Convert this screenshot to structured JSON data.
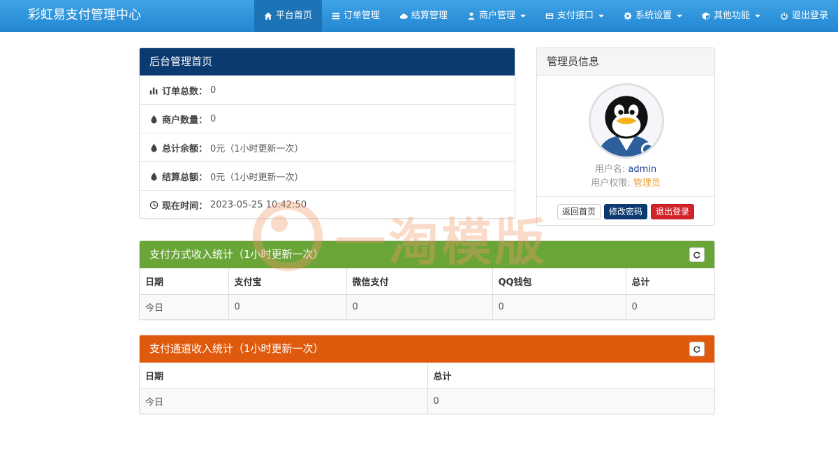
{
  "navbar": {
    "brand": "彩虹易支付管理中心",
    "items": [
      {
        "label": "平台首页",
        "icon": "home-icon",
        "active": true
      },
      {
        "label": "订单管理",
        "icon": "list-icon"
      },
      {
        "label": "结算管理",
        "icon": "cloud-icon"
      },
      {
        "label": "商户管理",
        "icon": "user-icon",
        "dropdown": true
      },
      {
        "label": "支付接口",
        "icon": "credit-card-icon",
        "dropdown": true
      },
      {
        "label": "系统设置",
        "icon": "gear-icon",
        "dropdown": true
      },
      {
        "label": "其他功能",
        "icon": "cube-icon",
        "dropdown": true
      },
      {
        "label": "退出登录",
        "icon": "power-icon"
      }
    ]
  },
  "dashboard": {
    "title": "后台管理首页",
    "rows": [
      {
        "label": "订单总数：",
        "value": "0",
        "icon": "bar-chart-icon"
      },
      {
        "label": "商户数量：",
        "value": "0",
        "icon": "droplet-icon"
      },
      {
        "label": "总计余额：",
        "value": "0元（1小时更新一次）",
        "icon": "droplet-icon"
      },
      {
        "label": "结算总额：",
        "value": "0元（1小时更新一次）",
        "icon": "droplet-icon"
      },
      {
        "label": "现在时间：",
        "value": "2023-05-25 10:42:50",
        "icon": "clock-icon"
      }
    ]
  },
  "admin": {
    "title": "管理员信息",
    "username_label": "用户名:",
    "username": "admin",
    "role_label": "用户权限:",
    "role": "管理员",
    "buttons": {
      "home": "返回首页",
      "change_password": "修改密码",
      "logout": "退出登录"
    }
  },
  "pay_method_stats": {
    "title": "支付方式收入统计（1小时更新一次）",
    "headers": [
      "日期",
      "支付宝",
      "微信支付",
      "QQ钱包",
      "总计"
    ],
    "rows": [
      [
        "今日",
        "0",
        "0",
        "0",
        "0"
      ]
    ]
  },
  "channel_stats": {
    "title": "支付通道收入统计（1小时更新一次）",
    "headers": [
      "日期",
      "总计"
    ],
    "rows": [
      [
        "今日",
        "0"
      ]
    ]
  },
  "watermark": "一淘模版",
  "colors": {
    "nav": "#2a8fda",
    "dashboard_header": "#0b3a70",
    "pay_header": "#6aa537",
    "channel_header": "#e05a0d",
    "danger": "#d2232a"
  }
}
